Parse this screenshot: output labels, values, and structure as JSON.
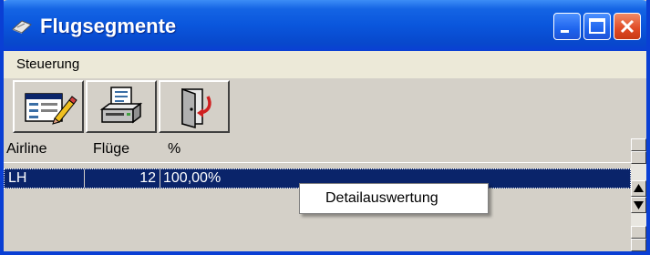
{
  "window": {
    "title": "Flugsegmente",
    "title_icon": "window-app-icon",
    "controls": [
      {
        "name": "minimize-button",
        "icon": "minimize-icon"
      },
      {
        "name": "maximize-button",
        "icon": "maximize-icon"
      },
      {
        "name": "close-button",
        "icon": "close-icon"
      }
    ]
  },
  "menu": {
    "items": [
      {
        "label": "Steuerung"
      }
    ]
  },
  "toolbar": {
    "buttons": [
      {
        "name": "edit-form-button",
        "icon": "form-edit-icon"
      },
      {
        "name": "print-button",
        "icon": "printer-icon"
      },
      {
        "name": "exit-button",
        "icon": "exit-door-icon"
      }
    ]
  },
  "grid": {
    "columns": [
      "Airline",
      "Flüge",
      "%"
    ],
    "rows": [
      {
        "airline": "LH",
        "fluege": "12",
        "percent": "100,00%",
        "selected": true
      }
    ]
  },
  "context_menu": {
    "items": [
      {
        "label": "Detailauswertung"
      }
    ]
  },
  "colors": {
    "titlebar": "#0a56dc",
    "selection": "#0a246a",
    "face": "#d4d0c8",
    "menubar": "#ece9d8"
  }
}
